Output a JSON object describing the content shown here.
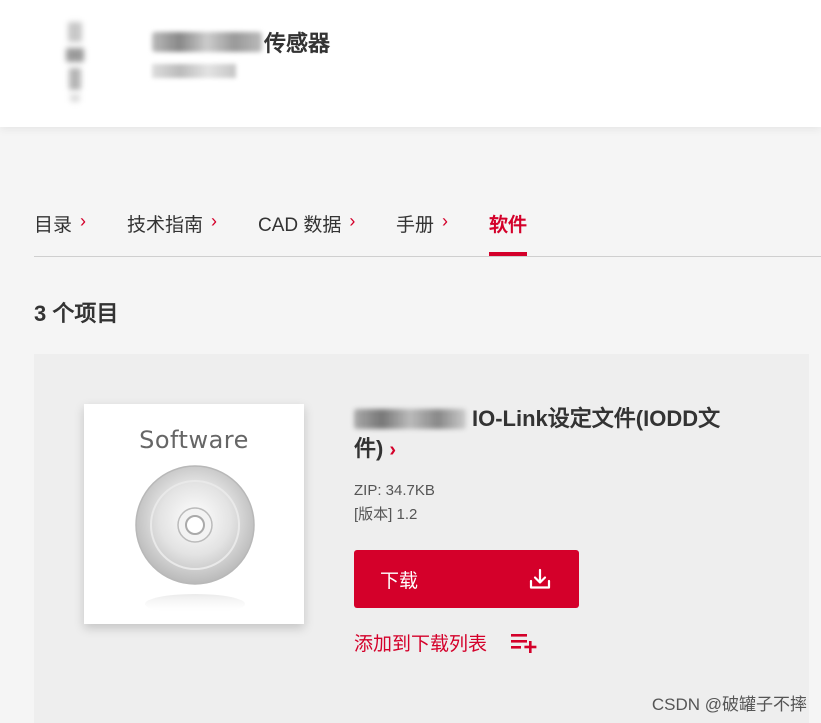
{
  "header": {
    "title_suffix": "传感器"
  },
  "tabs": [
    {
      "label": "目录",
      "chevron": "›",
      "active": false
    },
    {
      "label": "技术指南",
      "chevron": "›",
      "active": false
    },
    {
      "label": "CAD 数据",
      "chevron": "›",
      "active": false
    },
    {
      "label": "手册",
      "chevron": "›",
      "active": false
    },
    {
      "label": "软件",
      "chevron": "",
      "active": true
    }
  ],
  "results": {
    "count_label": "3 个项目"
  },
  "item": {
    "thumbnail_label": "Software",
    "title_line1": "IO-Link设定文件(IODD文",
    "title_line2": "件)",
    "title_chevron": "›",
    "file_info": "ZIP: 34.7KB",
    "version": "[版本] 1.2",
    "download_label": "下载",
    "add_to_list_label": "添加到下载列表"
  },
  "watermark": "CSDN @破罐子不摔",
  "colors": {
    "accent": "#d4002a",
    "card_bg": "#eeeeee",
    "page_bg": "#f5f5f5"
  },
  "icons": {
    "download": "download-icon",
    "add_list": "playlist-add-icon",
    "chevron": "chevron-right-icon",
    "software_disc": "cd-disc-icon"
  }
}
